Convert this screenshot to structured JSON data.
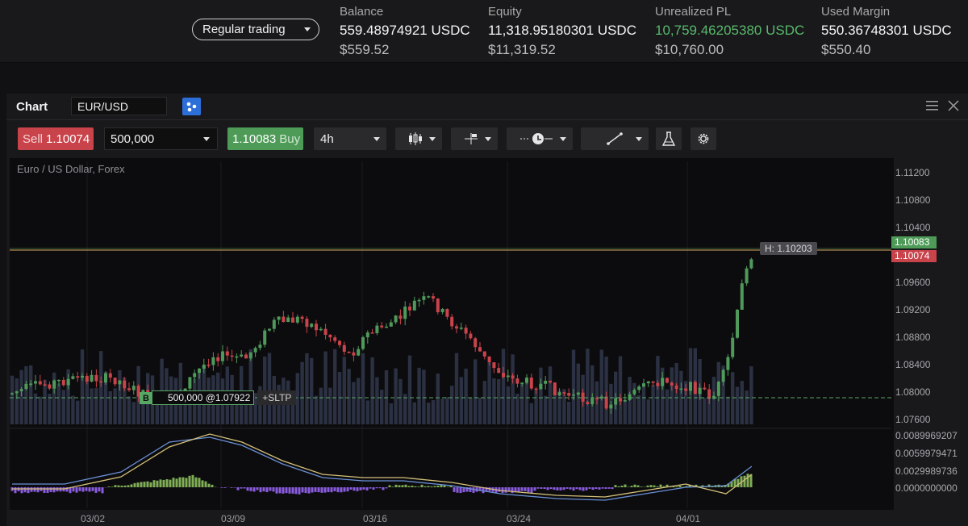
{
  "account": {
    "mode": "Regular trading",
    "stats": [
      {
        "title": "Balance",
        "value": "559.48974921 USDC",
        "usd": "$559.52"
      },
      {
        "title": "Equity",
        "value": "11,318.95180301 USDC",
        "usd": "$11,319.52"
      },
      {
        "title": "Unrealized PL",
        "value": "10,759.46205380 USDC",
        "usd": "$10,760.00"
      },
      {
        "title": "Used Margin",
        "value": "550.36748301 USDC",
        "usd": "$550.40"
      }
    ]
  },
  "panel": {
    "title": "Chart",
    "symbol": "EUR/USD"
  },
  "toolbar": {
    "sell_label": "Sell",
    "sell_price": "1.10074",
    "quantity": "500,000",
    "buy_price": "1.10083",
    "buy_label": "Buy",
    "timeframe": "4h"
  },
  "chart": {
    "instrument": "Euro / US Dollar, Forex",
    "price_ticks": [
      "1.11200",
      "1.10800",
      "1.10400",
      "1.09600",
      "1.09200",
      "1.08800",
      "1.08400",
      "1.08000",
      "1.07600"
    ],
    "ask_tag": "1.10083",
    "bid_tag": "1.10074",
    "high_label": "H: 1.10203",
    "position": {
      "side": "B",
      "text": "500,000 @1.07922",
      "sltp": "+SLTP"
    },
    "macd_ticks": [
      "0.0089969207",
      "0.0059979471",
      "0.0029989736",
      "0.0000000000"
    ],
    "dates": [
      "03/02",
      "03/09",
      "03/16",
      "03/24",
      "04/01"
    ],
    "colors": {
      "up": "#4f9a5b",
      "down": "#c9434b",
      "ask": "#4e9b58",
      "bid": "#c9434b"
    }
  }
}
